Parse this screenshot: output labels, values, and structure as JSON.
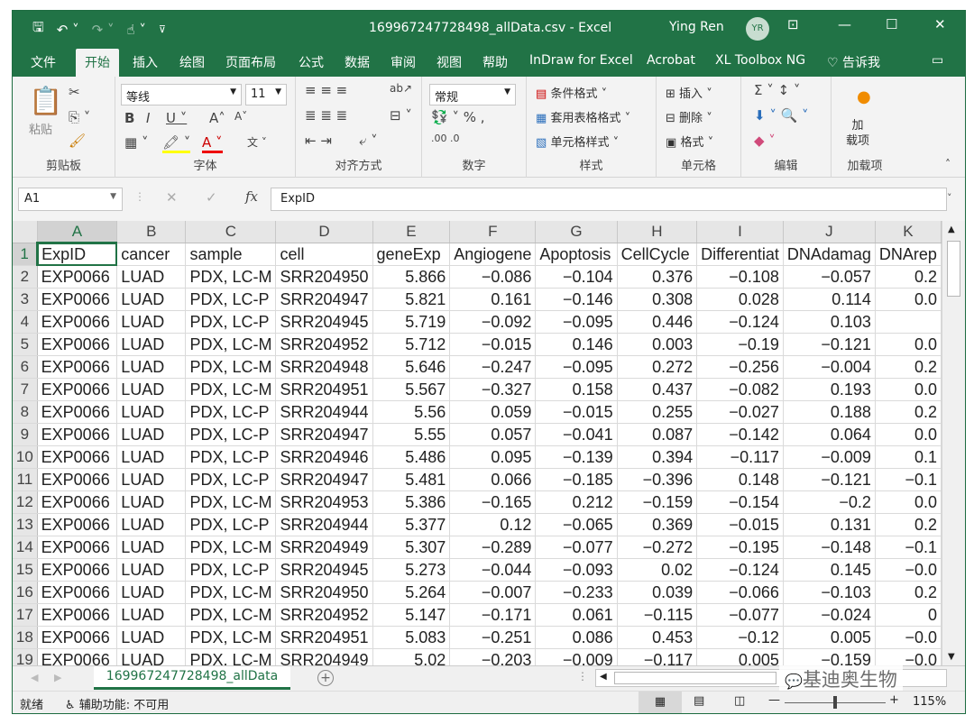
{
  "window": {
    "title": "169967247728498_allData.csv  -  Excel",
    "user": "Ying Ren",
    "initials": "YR"
  },
  "tabs": [
    "文件",
    "开始",
    "插入",
    "绘图",
    "页面布局",
    "公式",
    "数据",
    "审阅",
    "视图",
    "帮助",
    "InDraw for Excel",
    "Acrobat",
    "XL Toolbox NG",
    "告诉我"
  ],
  "ribbon": {
    "groups": {
      "clipboard": "剪贴板",
      "font": "字体",
      "align": "对齐方式",
      "number": "数字",
      "styles": "样式",
      "cells": "单元格",
      "editing": "编辑",
      "addins": "加载项"
    },
    "paste": "粘贴",
    "font_name": "等线",
    "font_size": "11",
    "number_format": "常规",
    "cond_format": "条件格式",
    "table_format": "套用表格格式",
    "cell_style": "单元格样式",
    "insert": "插入",
    "delete": "删除",
    "format": "格式",
    "addin_label": "加\n载项"
  },
  "formula": {
    "cell_ref": "A1",
    "content": "ExpID"
  },
  "columns": [
    "A",
    "B",
    "C",
    "D",
    "E",
    "F",
    "G",
    "H",
    "I",
    "J",
    "K"
  ],
  "rows": [
    [
      "ExpID",
      "cancer",
      "sample",
      "cell",
      "geneExp",
      "Angiogene",
      "Apoptosis",
      "CellCycle",
      "Differentiat",
      "DNAdamag",
      "DNArep"
    ],
    [
      "EXP0066",
      "LUAD",
      "PDX, LC-M",
      "SRR204950",
      "5.866",
      "−0.086",
      "−0.104",
      "0.376",
      "−0.108",
      "−0.057",
      "0.2"
    ],
    [
      "EXP0066",
      "LUAD",
      "PDX, LC-P",
      "SRR204947",
      "5.821",
      "0.161",
      "−0.146",
      "0.308",
      "0.028",
      "0.114",
      "0.0"
    ],
    [
      "EXP0066",
      "LUAD",
      "PDX, LC-P",
      "SRR204945",
      "5.719",
      "−0.092",
      "−0.095",
      "0.446",
      "−0.124",
      "0.103",
      ""
    ],
    [
      "EXP0066",
      "LUAD",
      "PDX, LC-M",
      "SRR204952",
      "5.712",
      "−0.015",
      "0.146",
      "0.003",
      "−0.19",
      "−0.121",
      "0.0"
    ],
    [
      "EXP0066",
      "LUAD",
      "PDX, LC-M",
      "SRR204948",
      "5.646",
      "−0.247",
      "−0.095",
      "0.272",
      "−0.256",
      "−0.004",
      "0.2"
    ],
    [
      "EXP0066",
      "LUAD",
      "PDX, LC-M",
      "SRR204951",
      "5.567",
      "−0.327",
      "0.158",
      "0.437",
      "−0.082",
      "0.193",
      "0.0"
    ],
    [
      "EXP0066",
      "LUAD",
      "PDX, LC-P",
      "SRR204944",
      "5.56",
      "0.059",
      "−0.015",
      "0.255",
      "−0.027",
      "0.188",
      "0.2"
    ],
    [
      "EXP0066",
      "LUAD",
      "PDX, LC-P",
      "SRR204947",
      "5.55",
      "0.057",
      "−0.041",
      "0.087",
      "−0.142",
      "0.064",
      "0.0"
    ],
    [
      "EXP0066",
      "LUAD",
      "PDX, LC-P",
      "SRR204946",
      "5.486",
      "0.095",
      "−0.139",
      "0.394",
      "−0.117",
      "−0.009",
      "0.1"
    ],
    [
      "EXP0066",
      "LUAD",
      "PDX, LC-P",
      "SRR204947",
      "5.481",
      "0.066",
      "−0.185",
      "−0.396",
      "0.148",
      "−0.121",
      "−0.1"
    ],
    [
      "EXP0066",
      "LUAD",
      "PDX, LC-M",
      "SRR204953",
      "5.386",
      "−0.165",
      "0.212",
      "−0.159",
      "−0.154",
      "−0.2",
      "0.0"
    ],
    [
      "EXP0066",
      "LUAD",
      "PDX, LC-P",
      "SRR204944",
      "5.377",
      "0.12",
      "−0.065",
      "0.369",
      "−0.015",
      "0.131",
      "0.2"
    ],
    [
      "EXP0066",
      "LUAD",
      "PDX, LC-M",
      "SRR204949",
      "5.307",
      "−0.289",
      "−0.077",
      "−0.272",
      "−0.195",
      "−0.148",
      "−0.1"
    ],
    [
      "EXP0066",
      "LUAD",
      "PDX, LC-P",
      "SRR204945",
      "5.273",
      "−0.044",
      "−0.093",
      "0.02",
      "−0.124",
      "0.145",
      "−0.0"
    ],
    [
      "EXP0066",
      "LUAD",
      "PDX, LC-M",
      "SRR204950",
      "5.264",
      "−0.007",
      "−0.233",
      "0.039",
      "−0.066",
      "−0.103",
      "0.2"
    ],
    [
      "EXP0066",
      "LUAD",
      "PDX, LC-M",
      "SRR204952",
      "5.147",
      "−0.171",
      "0.061",
      "−0.115",
      "−0.077",
      "−0.024",
      "0"
    ],
    [
      "EXP0066",
      "LUAD",
      "PDX, LC-M",
      "SRR204951",
      "5.083",
      "−0.251",
      "0.086",
      "0.453",
      "−0.12",
      "0.005",
      "−0.0"
    ],
    [
      "EXP0066",
      "LUAD",
      "PDX, LC-M",
      "SRR204949",
      "5.02",
      "−0.203",
      "−0.009",
      "−0.117",
      "0.005",
      "−0.159",
      "−0.0"
    ]
  ],
  "sheet": {
    "name": "169967247728498_allData"
  },
  "status": {
    "ready": "就绪",
    "accessibility": "辅助功能: 不可用",
    "zoom": "115%"
  },
  "watermark": "基迪奥生物"
}
